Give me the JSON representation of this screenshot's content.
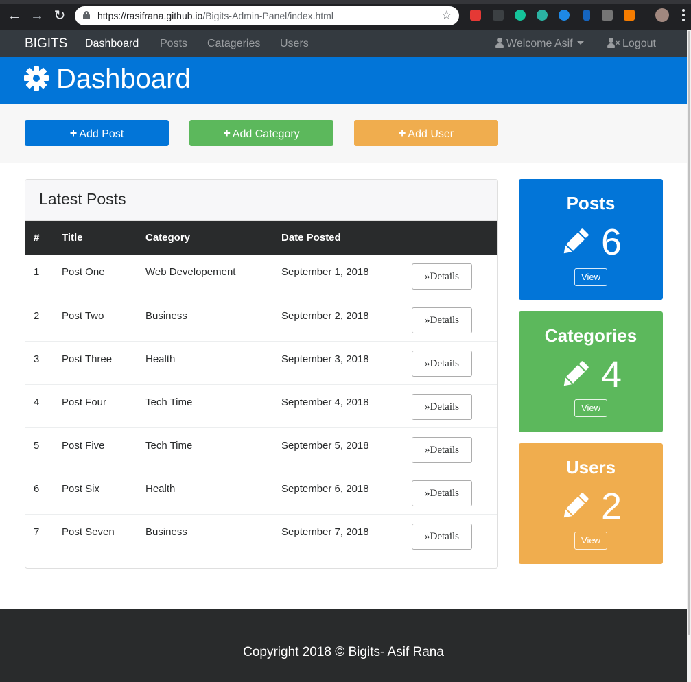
{
  "browser": {
    "url_host": "https://rasifrana.github.io",
    "url_path": "/Bigits-Admin-Panel/index.html"
  },
  "navbar": {
    "brand": "BIGITS",
    "links": [
      "Dashboard",
      "Posts",
      "Catageries",
      "Users"
    ],
    "welcome": "Welcome Asif",
    "logout": "Logout"
  },
  "header": {
    "title": "Dashboard",
    "icon": "gear-icon"
  },
  "actions": {
    "add_post": "Add Post",
    "add_category": "Add Category",
    "add_user": "Add User"
  },
  "latest_posts": {
    "title": "Latest Posts",
    "columns": [
      "#",
      "Title",
      "Category",
      "Date Posted"
    ],
    "details_label": "Details",
    "rows": [
      {
        "num": "1",
        "title": "Post One",
        "category": "Web Developement",
        "date": "September 1, 2018"
      },
      {
        "num": "2",
        "title": "Post Two",
        "category": "Business",
        "date": "September 2, 2018"
      },
      {
        "num": "3",
        "title": "Post Three",
        "category": "Health",
        "date": "September 3, 2018"
      },
      {
        "num": "4",
        "title": "Post Four",
        "category": "Tech Time",
        "date": "September 4, 2018"
      },
      {
        "num": "5",
        "title": "Post Five",
        "category": "Tech Time",
        "date": "September 5, 2018"
      },
      {
        "num": "6",
        "title": "Post Six",
        "category": "Health",
        "date": "September 6, 2018"
      },
      {
        "num": "7",
        "title": "Post Seven",
        "category": "Business",
        "date": "September 7, 2018"
      }
    ]
  },
  "stats": [
    {
      "title": "Posts",
      "count": "6",
      "view": "View",
      "color": "#0275d8",
      "icon": "pencil-icon"
    },
    {
      "title": "Categories",
      "count": "4",
      "view": "View",
      "color": "#5cb85c",
      "icon": "pencil-icon"
    },
    {
      "title": "Users",
      "count": "2",
      "view": "View",
      "color": "#f0ad4e",
      "icon": "pencil-icon"
    }
  ],
  "footer": {
    "text": "Copyright 2018 © Bigits- Asif Rana"
  },
  "colors": {
    "primary": "#0275d8",
    "success": "#5cb85c",
    "warning": "#f0ad4e",
    "dark": "#343a40"
  }
}
